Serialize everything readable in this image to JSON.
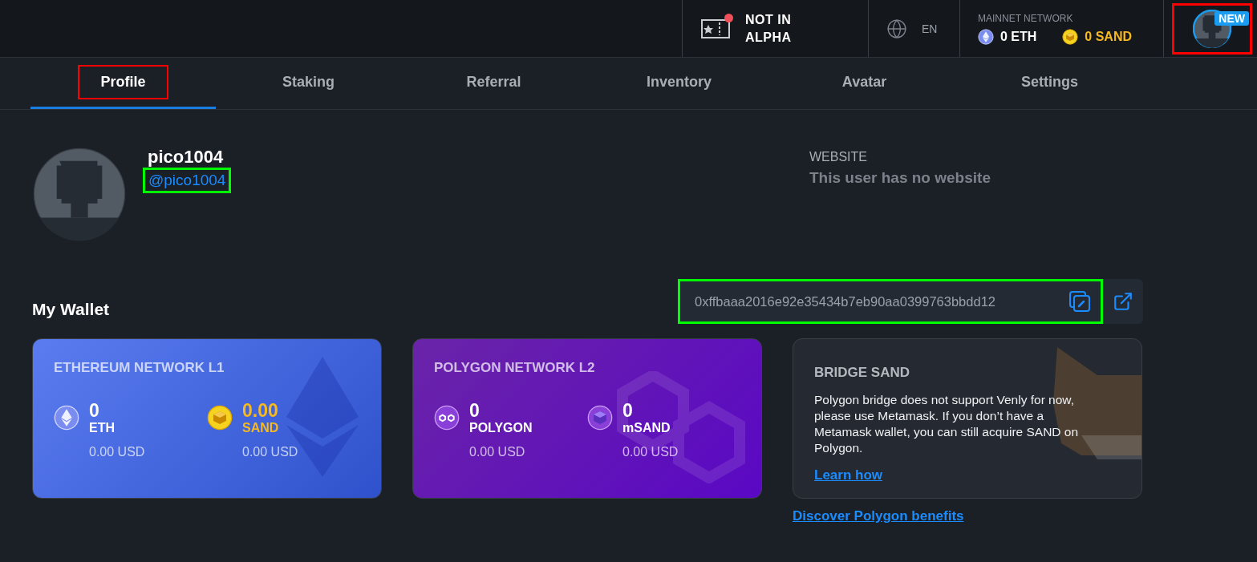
{
  "top_bar": {
    "alpha_badge": {
      "lines": [
        "NOT IN",
        "ALPHA"
      ],
      "alert": true
    },
    "language": "EN",
    "network": {
      "label": "MAINNET NETWORK",
      "balances": [
        {
          "kind": "eth",
          "amount": "0 ETH"
        },
        {
          "kind": "sand",
          "amount": "0 SAND"
        }
      ]
    },
    "account": {
      "badge": "NEW",
      "color": "#ff0000"
    }
  },
  "tabs": [
    {
      "label": "Profile",
      "selected": true,
      "color": "#ff0000"
    },
    {
      "label": "Staking",
      "selected": false
    },
    {
      "label": "Referral",
      "selected": false
    },
    {
      "label": "Inventory",
      "selected": false
    },
    {
      "label": "Avatar",
      "selected": false
    },
    {
      "label": "Settings",
      "selected": false
    }
  ],
  "profile": {
    "name": "pico1004",
    "handle": {
      "text": "@pico1004",
      "color": "#00ff00"
    },
    "website_label": "WEBSITE",
    "website_value": "This user has no website"
  },
  "wallet": {
    "title": "My Wallet",
    "address": {
      "text": "0xffbaaa2016e92e35434b7eb90aa0399763bbdd12",
      "color": "#00ff00"
    }
  },
  "networks": [
    {
      "kind": "ethereum",
      "title": "ETHEREUM NETWORK L1",
      "assets": [
        {
          "kind": "eth",
          "amount": "0",
          "symbol": "ETH",
          "usd": "0.00 USD"
        },
        {
          "kind": "sand",
          "amount": "0.00",
          "symbol": "SAND",
          "usd": "0.00 USD"
        }
      ]
    },
    {
      "kind": "polygon",
      "title": "POLYGON NETWORK L2",
      "assets": [
        {
          "kind": "polygon",
          "amount": "0",
          "symbol": "POLYGON",
          "usd": "0.00 USD"
        },
        {
          "kind": "msand",
          "amount": "0",
          "symbol": "mSAND",
          "usd": "0.00 USD"
        }
      ]
    }
  ],
  "bridge": {
    "title": "BRIDGE SAND",
    "text": "Polygon bridge does not support Venly for now, please use Metamask. If you don’t have a Metamask wallet, you can still acquire SAND on Polygon.",
    "link": "Learn how"
  },
  "footer_link": "Discover Polygon benefits"
}
